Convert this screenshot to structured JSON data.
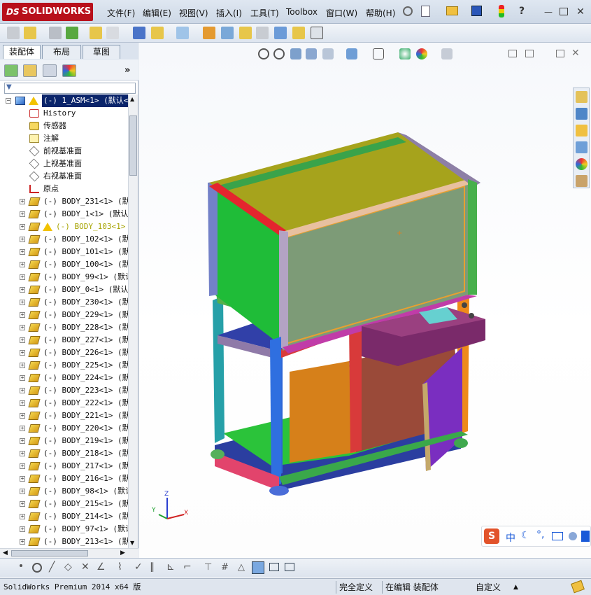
{
  "app": {
    "logo_text": "SOLIDWORKS",
    "logo_prefix": "DS"
  },
  "menu": {
    "items": [
      "文件(F)",
      "编辑(E)",
      "视图(V)",
      "插入(I)",
      "工具(T)",
      "Toolbox",
      "窗口(W)",
      "帮助(H)"
    ]
  },
  "panel": {
    "tabs": [
      "装配体",
      "布局",
      "草图"
    ],
    "active_tab": "装配体",
    "filter_label": "▼",
    "expand_label": "»"
  },
  "tree": {
    "root": "(-) 1_ASM<1> (默认<默",
    "items": [
      {
        "label": "History",
        "icon": "history-icon"
      },
      {
        "label": "传感器",
        "icon": "sensor-icon"
      },
      {
        "label": "注解",
        "icon": "annotation-icon"
      },
      {
        "label": "前视基准面",
        "icon": "plane-icon"
      },
      {
        "label": "上视基准面",
        "icon": "plane-icon"
      },
      {
        "label": "右视基准面",
        "icon": "plane-icon"
      },
      {
        "label": "原点",
        "icon": "origin-icon"
      },
      {
        "label": "(-) BODY_231<1> (默认",
        "icon": "part-icon"
      },
      {
        "label": "(-) BODY_1<1> (默认<",
        "icon": "part-icon"
      },
      {
        "label": "(-) BODY_103<1> (",
        "icon": "part-icon",
        "warning": true
      },
      {
        "label": "(-) BODY_102<1> (默认",
        "icon": "part-icon"
      },
      {
        "label": "(-) BODY_101<1> (默认",
        "icon": "part-icon"
      },
      {
        "label": "(-) BODY_100<1> (默认",
        "icon": "part-icon"
      },
      {
        "label": "(-) BODY_99<1> (默认",
        "icon": "part-icon"
      },
      {
        "label": "(-) BODY_0<1> (默认<",
        "icon": "part-icon"
      },
      {
        "label": "(-) BODY_230<1> (默认",
        "icon": "part-icon"
      },
      {
        "label": "(-) BODY_229<1> (默认",
        "icon": "part-icon"
      },
      {
        "label": "(-) BODY_228<1> (默认",
        "icon": "part-icon"
      },
      {
        "label": "(-) BODY_227<1> (默认",
        "icon": "part-icon"
      },
      {
        "label": "(-) BODY_226<1> (默认",
        "icon": "part-icon"
      },
      {
        "label": "(-) BODY_225<1> (默认",
        "icon": "part-icon"
      },
      {
        "label": "(-) BODY_224<1> (默认",
        "icon": "part-icon"
      },
      {
        "label": "(-) BODY_223<1> (默认",
        "icon": "part-icon"
      },
      {
        "label": "(-) BODY_222<1> (默认",
        "icon": "part-icon"
      },
      {
        "label": "(-) BODY_221<1> (默认",
        "icon": "part-icon"
      },
      {
        "label": "(-) BODY_220<1> (默认",
        "icon": "part-icon"
      },
      {
        "label": "(-) BODY_219<1> (默认",
        "icon": "part-icon"
      },
      {
        "label": "(-) BODY_218<1> (默认",
        "icon": "part-icon"
      },
      {
        "label": "(-) BODY_217<1> (默认",
        "icon": "part-icon"
      },
      {
        "label": "(-) BODY_216<1> (默认",
        "icon": "part-icon"
      },
      {
        "label": "(-) BODY_98<1> (默认",
        "icon": "part-icon"
      },
      {
        "label": "(-) BODY_215<1> (默认",
        "icon": "part-icon"
      },
      {
        "label": "(-) BODY_214<1> (默认",
        "icon": "part-icon"
      },
      {
        "label": "(-) BODY_97<1> (默认",
        "icon": "part-icon"
      },
      {
        "label": "(-) BODY_213<1> (默认",
        "icon": "part-icon"
      }
    ]
  },
  "viewport": {
    "triad_x": "X",
    "triad_y": "Y",
    "triad_z": "Z"
  },
  "ime": {
    "label": "中"
  },
  "status": {
    "app_version": "SolidWorks Premium 2014 x64 版",
    "definition": "完全定义",
    "mode": "在编辑 装配体",
    "units": "自定义"
  },
  "colors": {
    "brand": "#b8101b",
    "selection": "#0a246a"
  }
}
